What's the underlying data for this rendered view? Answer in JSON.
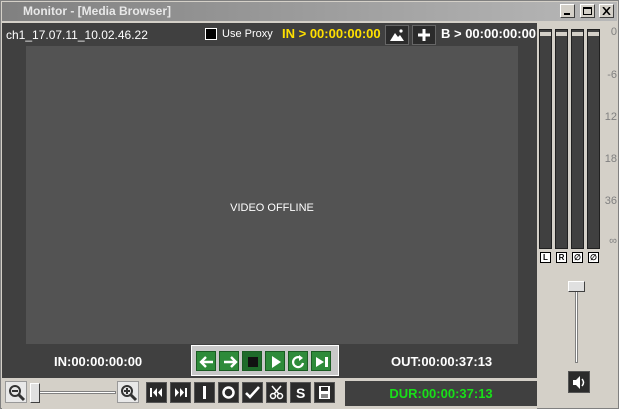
{
  "window": {
    "title": "Monitor - [Media Browser]"
  },
  "topbar": {
    "clip_name": "ch1_17.07.11_10.02.46.22",
    "use_proxy_label": "Use Proxy",
    "use_proxy_checked": false,
    "in_timecode": "IN > 00:00:00:00",
    "b_timecode": "B > 00:00:00:00"
  },
  "video": {
    "status": "VIDEO OFFLINE"
  },
  "bottom": {
    "in_label": "IN:00:00:00:00",
    "out_label": "OUT:00:00:37:13",
    "duration": "DUR:00:00:37:13"
  },
  "meters": {
    "channels": [
      "L",
      "R",
      "∅",
      "∅"
    ],
    "scale": [
      "0",
      "-6",
      "12",
      "18",
      "36",
      "∞"
    ]
  },
  "colors": {
    "timecode_in": "#ffe000",
    "duration": "#18e018",
    "transport": "#2e8b3a",
    "marker": "#e00000"
  },
  "icons": {
    "transport": [
      "left-arrow-icon",
      "right-arrow-icon",
      "stop-icon",
      "play-icon",
      "loop-icon",
      "play-to-end-icon"
    ],
    "strip": [
      "go-to-start-icon",
      "go-to-end-icon",
      "mark-in-icon",
      "mark-out-icon",
      "check-icon",
      "scissors-icon",
      "s-icon",
      "save-icon"
    ]
  }
}
